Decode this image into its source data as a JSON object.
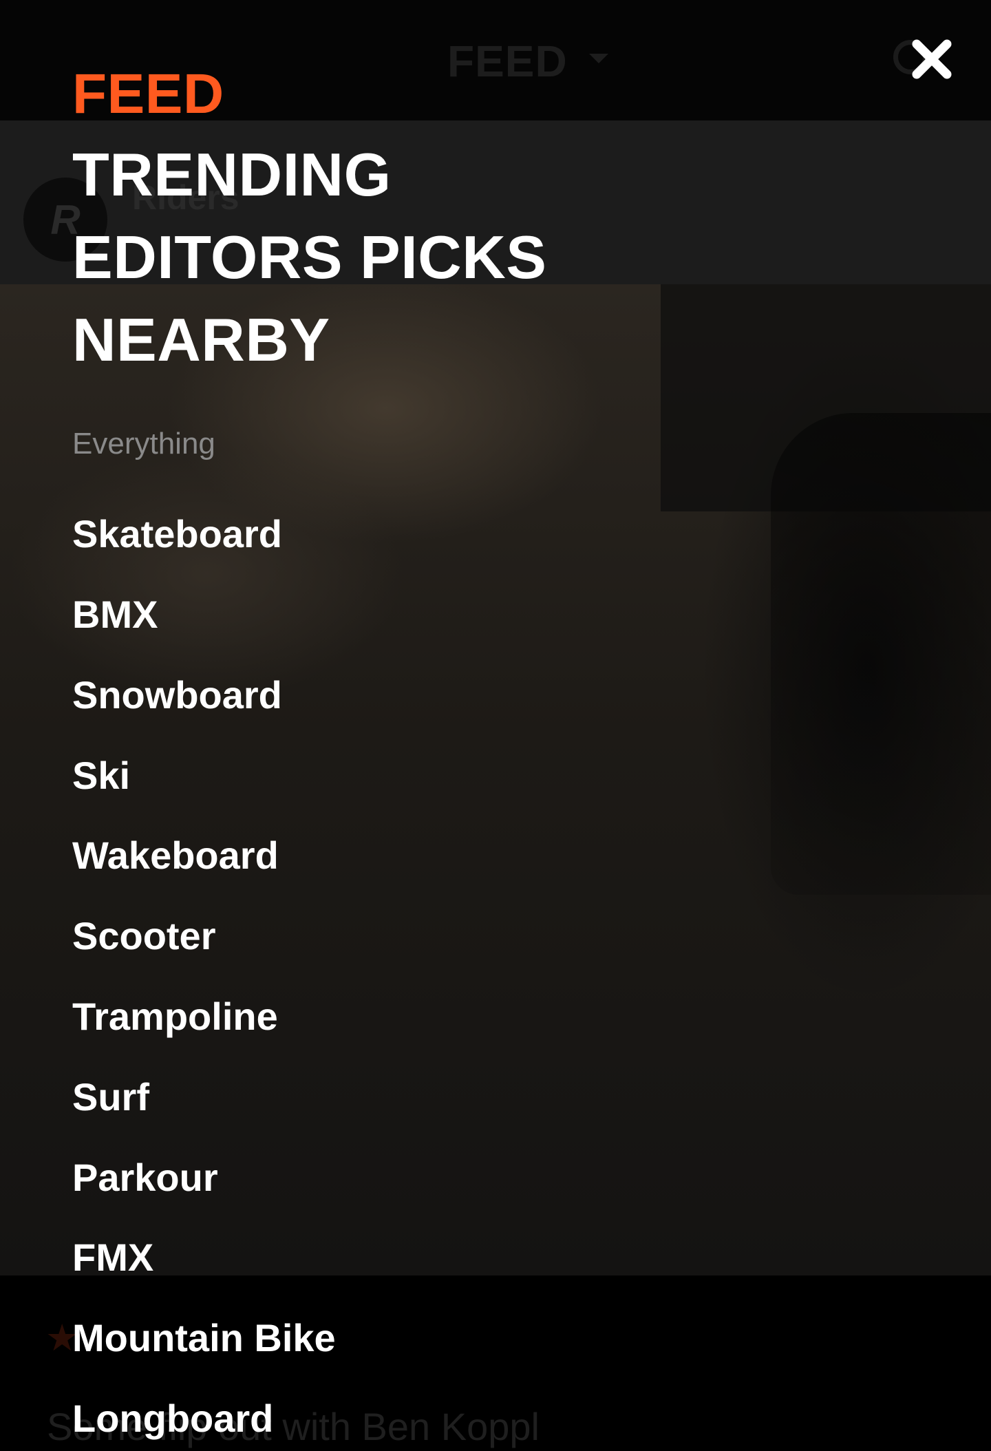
{
  "background": {
    "header_title": "FEED",
    "channel_name": "Riders",
    "avatar_letter": "R",
    "caption": "Some flip out with Ben Koppl",
    "search_icon": "search-icon",
    "caret_icon": "chevron-down-icon",
    "star_icon": "star-icon"
  },
  "menu": {
    "close_icon": "close-icon",
    "primary": [
      {
        "label": "FEED",
        "active": true
      },
      {
        "label": "TRENDING",
        "active": false
      },
      {
        "label": "EDITORS PICKS",
        "active": false
      },
      {
        "label": "NEARBY",
        "active": false
      }
    ],
    "section_label": "Everything",
    "categories": [
      "Skateboard",
      "BMX",
      "Snowboard",
      "Ski",
      "Wakeboard",
      "Scooter",
      "Trampoline",
      "Surf",
      "Parkour",
      "FMX",
      "Mountain Bike",
      "Longboard"
    ]
  },
  "colors": {
    "accent": "#ff5a1f",
    "text": "#ffffff",
    "muted": "#8a8a8a"
  }
}
